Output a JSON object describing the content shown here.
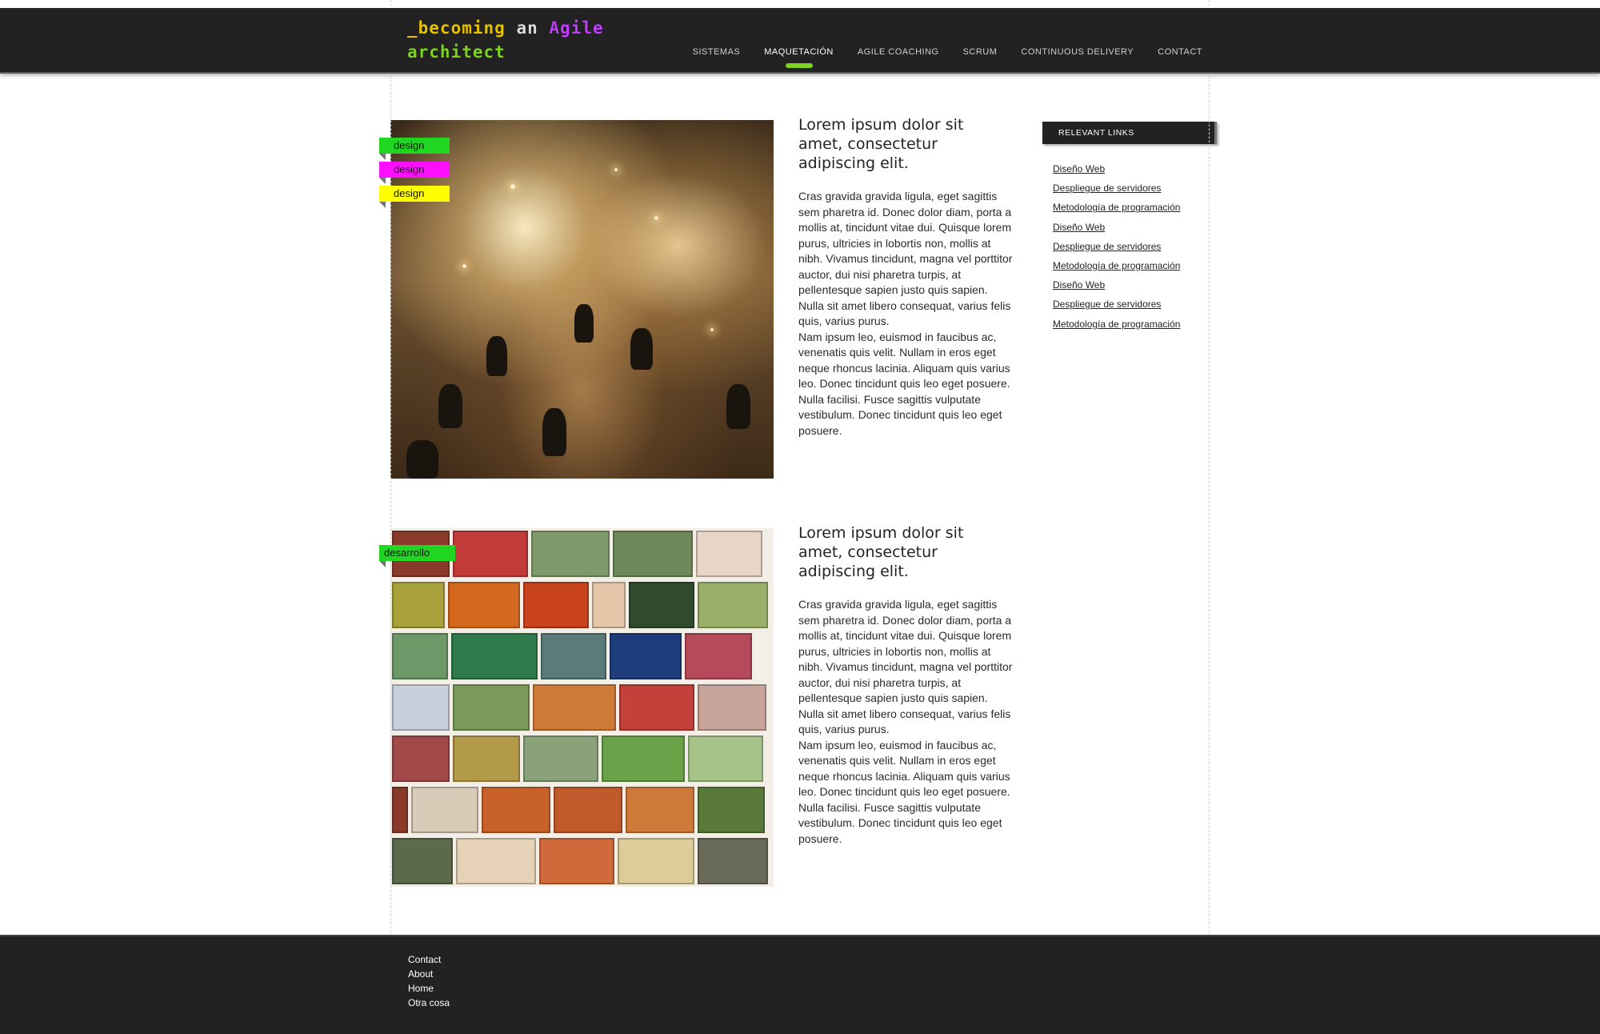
{
  "header": {
    "logo": {
      "part1": "_becoming",
      "part2": "an",
      "part3": "Agile",
      "part4": "architect"
    },
    "nav": [
      {
        "label": "SISTEMAS"
      },
      {
        "label": "MAQUETACIÓN"
      },
      {
        "label": "AGILE COACHING"
      },
      {
        "label": "SCRUM"
      },
      {
        "label": "CONTINUOUS DELIVERY"
      },
      {
        "label": "CONTACT"
      }
    ],
    "active_nav": "MAQUETACIÓN"
  },
  "posts": [
    {
      "tags": [
        "design",
        "design",
        "design"
      ],
      "title": "Lorem ipsum dolor sit amet, consectetur adipiscing elit.",
      "paragraphs": [
        "Cras gravida gravida ligula, eget sagittis sem pharetra id. Donec dolor diam, porta a mollis at, tincidunt vitae dui. Quisque lorem purus, ultricies in lobortis non, mollis at nibh. Vivamus tincidunt, magna vel porttitor auctor, dui nisi pharetra turpis, at pellentesque sapien justo quis sapien. Nulla sit amet libero consequat, varius felis quis, varius purus.",
        "Nam ipsum leo, euismod in faucibus ac, venenatis quis velit. Nullam in eros eget neque rhoncus lacinia. Aliquam quis varius leo. Donec tincidunt quis leo eget posuere.",
        "Nulla facilisi. Fusce sagittis vulputate vestibulum.  Donec tincidunt quis leo eget posuere."
      ]
    },
    {
      "tags": [
        "desarrollo"
      ],
      "title": "Lorem ipsum dolor sit amet, consectetur adipiscing elit.",
      "paragraphs": [
        "Cras gravida gravida ligula, eget sagittis sem pharetra id. Donec dolor diam, porta a mollis at, tincidunt vitae dui. Quisque lorem purus, ultricies in lobortis non, mollis at nibh. Vivamus tincidunt, magna vel porttitor auctor, dui nisi pharetra turpis, at pellentesque sapien justo quis sapien. Nulla sit amet libero consequat, varius felis quis, varius purus.",
        "Nam ipsum leo, euismod in faucibus ac, venenatis quis velit. Nullam in eros eget neque rhoncus lacinia. Aliquam quis varius leo. Donec tincidunt quis leo eget posuere.",
        "Nulla facilisi. Fusce sagittis vulputate vestibulum.  Donec tincidunt quis leo eget posuere."
      ]
    }
  ],
  "sidebar": {
    "heading": "RELEVANT LINKS",
    "links": [
      "Diseño Web",
      "Despliegue de servidores",
      "Metodología de programación",
      "Diseño Web",
      "Despliegue de servidores",
      "Metodología de programación",
      "Diseño Web",
      "Despliegue de servidores",
      "Metodología de programación"
    ]
  },
  "footer": {
    "links": [
      "Contact",
      "About",
      "Home",
      "Otra cosa"
    ]
  },
  "colors": {
    "header_bg": "#222222",
    "accent_green": "#7ed321",
    "tag_green": "#21d620",
    "tag_pink": "#ff0fff",
    "tag_yellow": "#ffff00",
    "logo_yellow": "#e6c300",
    "logo_purple": "#c43cff"
  }
}
